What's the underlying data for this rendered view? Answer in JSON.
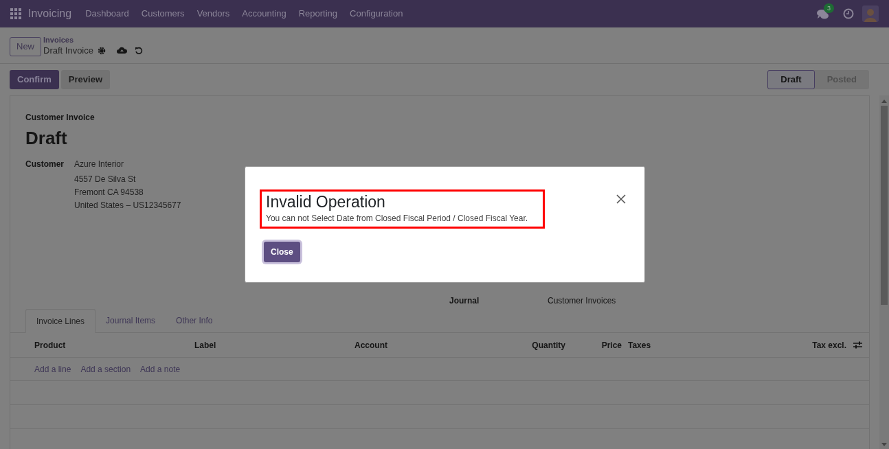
{
  "navbar": {
    "app_name": "Invoicing",
    "menu": [
      "Dashboard",
      "Customers",
      "Vendors",
      "Accounting",
      "Reporting",
      "Configuration"
    ],
    "chat_badge": "3"
  },
  "control_panel": {
    "new_button": "New",
    "breadcrumb": "Invoices",
    "record": "Draft Invoice"
  },
  "actions": [
    {
      "label": "Confirm",
      "kind": "primary"
    },
    {
      "label": "Preview",
      "kind": "secondary"
    }
  ],
  "status": [
    {
      "label": "Draft",
      "selected": true
    },
    {
      "label": "Posted",
      "selected": false
    }
  ],
  "form": {
    "type_label": "Customer Invoice",
    "title": "Draft",
    "customer_label": "Customer",
    "customer_name": "Azure Interior",
    "address": [
      "4557 De Silva St",
      "Fremont CA 94538",
      "United States – US12345677"
    ],
    "journal_label": "Journal",
    "journal_value": "Customer Invoices"
  },
  "tabs": [
    {
      "label": "Invoice Lines",
      "selected": true
    },
    {
      "label": "Journal Items",
      "selected": false
    },
    {
      "label": "Other Info",
      "selected": false
    }
  ],
  "table": {
    "columns": [
      "Product",
      "Label",
      "Account",
      "Quantity",
      "Price",
      "Taxes",
      "Tax excl."
    ],
    "add_links": [
      "Add a line",
      "Add a section",
      "Add a note"
    ]
  },
  "dialog": {
    "title": "Invalid Operation",
    "message": "You can not Select Date from Closed Fiscal Period / Closed Fiscal Year.",
    "button": "Close",
    "highlighted": true
  }
}
